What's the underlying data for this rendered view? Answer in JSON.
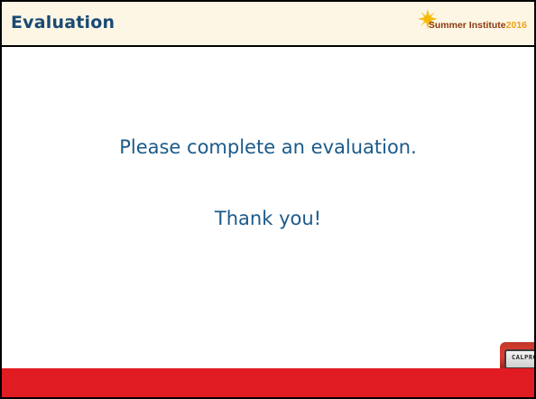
{
  "slide": {
    "title": "Evaluation",
    "logo": {
      "text": "Summer Institute",
      "year": "2016"
    },
    "body_line_1": "Please complete an evaluation.",
    "body_line_2": "Thank you!",
    "footer_logo_text": "CALPRO"
  },
  "colors": {
    "header_bg": "#fdf6e4",
    "title_color": "#1a4a74",
    "body_text_color": "#1b5a8a",
    "footer_bar": "#e01b22",
    "logo_year": "#f2a10f"
  },
  "icons": {
    "sun": "sun-icon"
  }
}
